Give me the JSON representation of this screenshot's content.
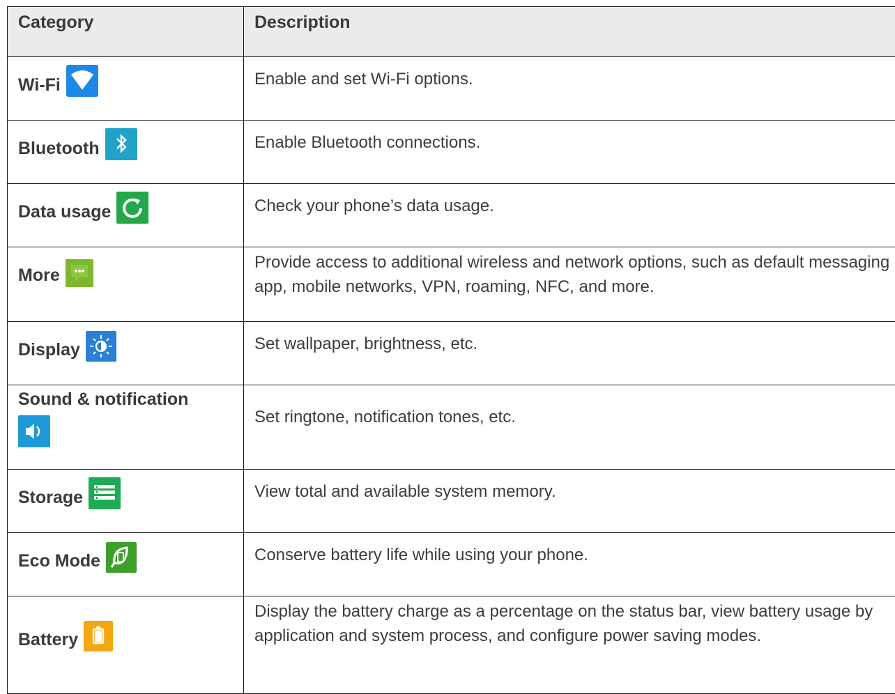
{
  "header": {
    "category": "Category",
    "description": "Description"
  },
  "rows": [
    {
      "category": "Wi-Fi",
      "icon": "wifi-icon",
      "description": "Enable and set Wi-Fi options."
    },
    {
      "category": "Bluetooth",
      "icon": "bluetooth-icon",
      "description": "Enable Bluetooth connections."
    },
    {
      "category": "Data usage",
      "icon": "data-usage-icon",
      "description": "Check your phone’s data usage."
    },
    {
      "category": "More",
      "icon": "more-icon",
      "description": "Provide access to additional wireless and network options, such as default messaging app, mobile networks, VPN, roaming, NFC, and more."
    },
    {
      "category": "Display",
      "icon": "display-icon",
      "description": "Set wallpaper, brightness, etc."
    },
    {
      "category": "Sound & notification",
      "icon": "sound-icon",
      "description": "Set ringtone, notification tones, etc."
    },
    {
      "category": "Storage",
      "icon": "storage-icon",
      "description": "View total and available system memory."
    },
    {
      "category": "Eco Mode",
      "icon": "eco-mode-icon",
      "description": "Conserve battery life while using your phone."
    },
    {
      "category": "Battery",
      "icon": "battery-icon",
      "description": "Display the battery charge as a percentage on the status bar, view battery usage by application and system process, and configure power saving modes."
    }
  ],
  "colors": {
    "header_bg": "#ebebeb",
    "border": "#1a1a1a",
    "text": "#3d3d3d"
  }
}
